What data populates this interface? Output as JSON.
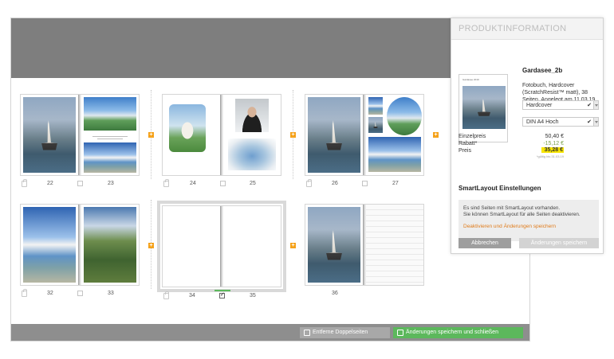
{
  "colors": {
    "orange": "#f5a21b",
    "green": "#5cb85c",
    "gray_btn": "#a8a8a8",
    "link": "#e07c1c",
    "highlight": "#f7e500"
  },
  "editor": {
    "spreads": [
      {
        "left_page": "22",
        "right_page": "23"
      },
      {
        "left_page": "24",
        "right_page": "25"
      },
      {
        "left_page": "26",
        "right_page": "27"
      },
      {
        "left_page": "32",
        "right_page": "33"
      },
      {
        "left_page": "34",
        "right_page": "35"
      },
      {
        "left_page": "36",
        "right_page": ""
      }
    ],
    "buttons": {
      "remove_spreads": "Entferne Doppelseiten",
      "save_close": "Änderungen speichern und schließen"
    }
  },
  "panel": {
    "header": "PRODUKTINFORMATION",
    "title": "Gardasee_2b",
    "description": "Fotobuch, Hardcover (ScratchResist™ matt), 38 Seiten, Angelegt am 11.03.19, 56 Bilder",
    "thumb_label": "Gardasee 2019",
    "cover_select": "Hardcover",
    "format_select": "DIN A4 Hoch",
    "prices": {
      "unit_label": "Einzelpreis",
      "unit_value": "50,40 €",
      "discount_label": "Rabatt*",
      "discount_value": "-15,12 €",
      "total_label": "Preis",
      "total_value": "35,28 €",
      "note": "*gültig bis 31.03.19"
    },
    "smartlayout": {
      "title": "SmartLayout Einstellungen",
      "line1": "Es sind Seiten mit SmartLayout vorhanden.",
      "line2": "Sie können SmartLayout für alle Seiten deaktivieren.",
      "link": "Deaktivieren und Änderungen speichern"
    },
    "buttons": {
      "cancel": "Abbrechen",
      "save": "Änderungen speichern"
    }
  }
}
